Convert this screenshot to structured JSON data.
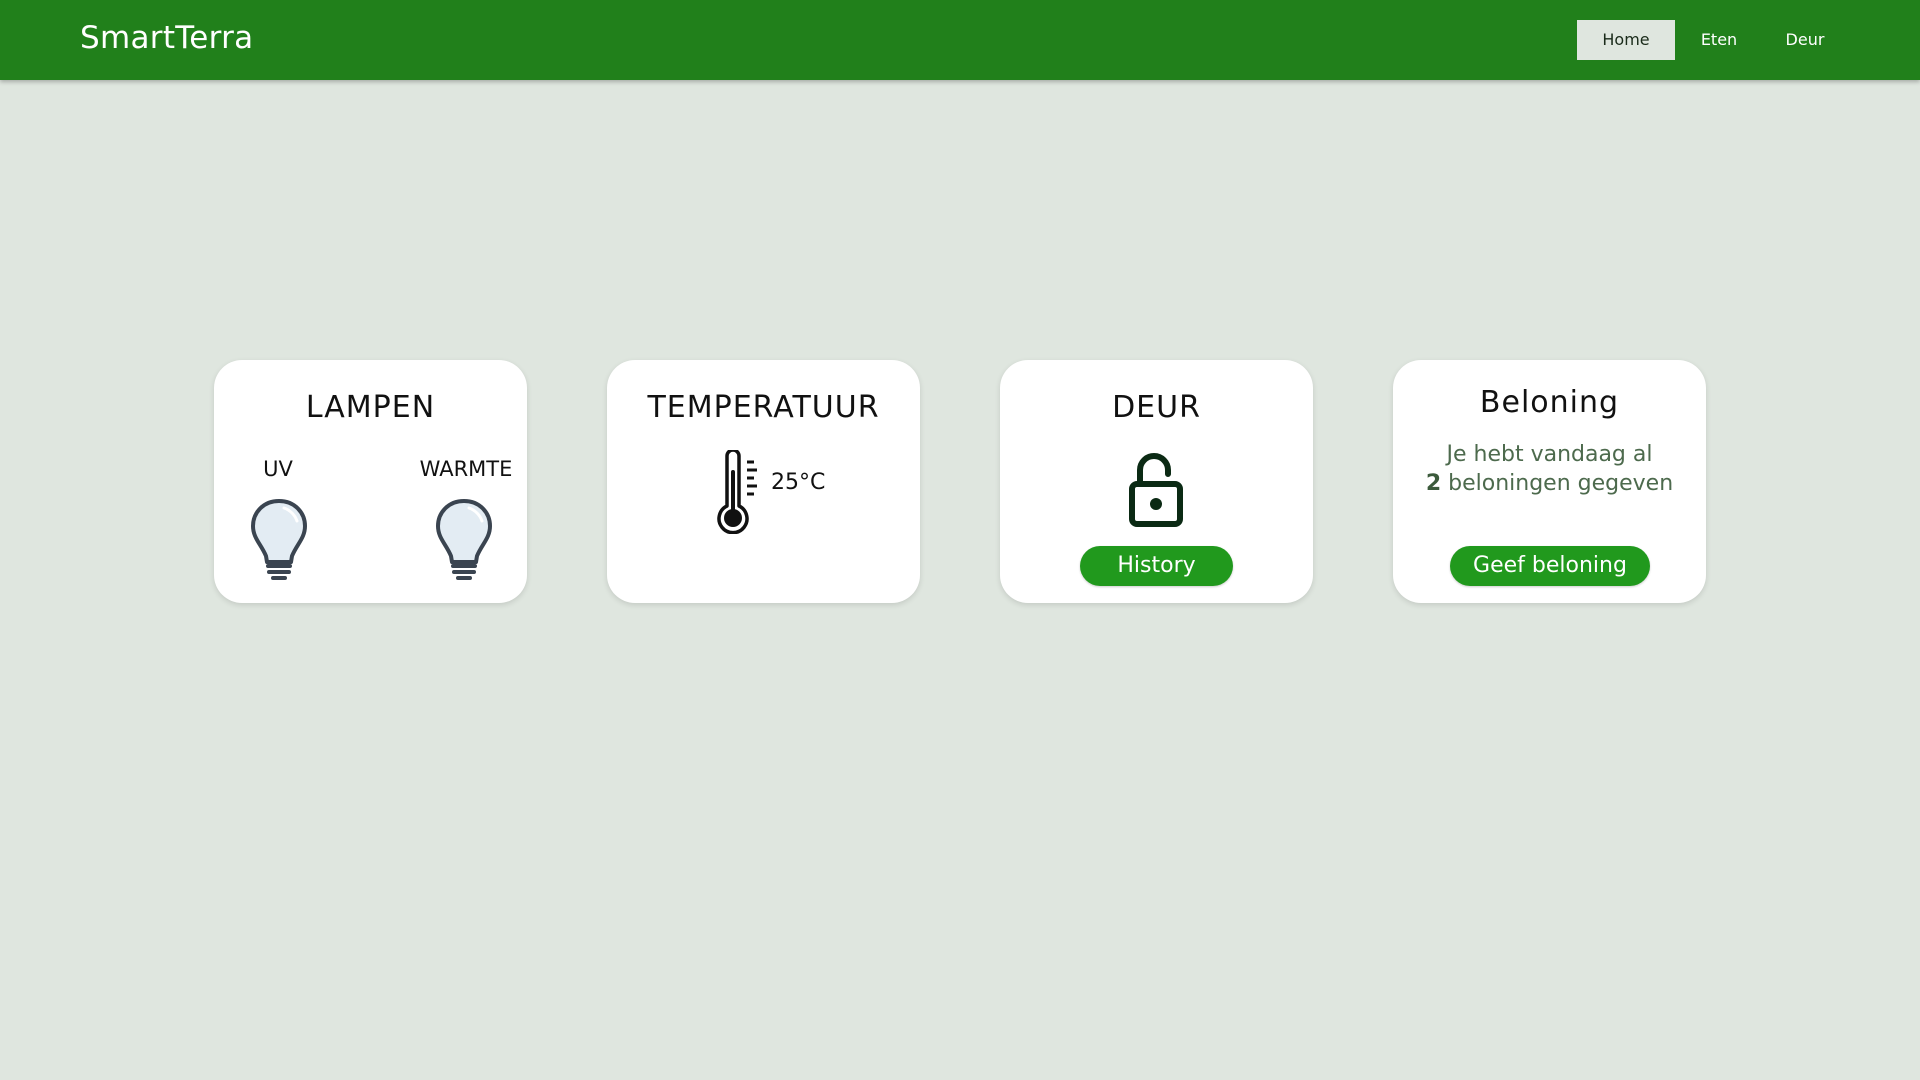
{
  "header": {
    "brand": "SmartTerra",
    "nav": [
      {
        "label": "Home",
        "active": true
      },
      {
        "label": "Eten",
        "active": false
      },
      {
        "label": "Deur",
        "active": false
      }
    ]
  },
  "lampen": {
    "title": "LAMPEN",
    "uv_label": "UV",
    "warmte_label": "WARMTE",
    "icons": [
      "lightbulb-icon",
      "lightbulb-icon"
    ]
  },
  "temperatuur": {
    "title": "TEMPERATUUR",
    "value": "25°C",
    "icon": "thermometer-icon"
  },
  "deur": {
    "title": "DEUR",
    "icon": "unlocked-padlock-icon",
    "history_label": "History"
  },
  "beloning": {
    "title": "Beloning",
    "text_before": "Je hebt vandaag al",
    "count": "2",
    "text_after": "beloningen gegeven",
    "button_label": "Geef beloning"
  },
  "colors": {
    "header": "#21801b",
    "button": "#21991d",
    "background": "#dfe6df",
    "card": "#ffffff"
  }
}
